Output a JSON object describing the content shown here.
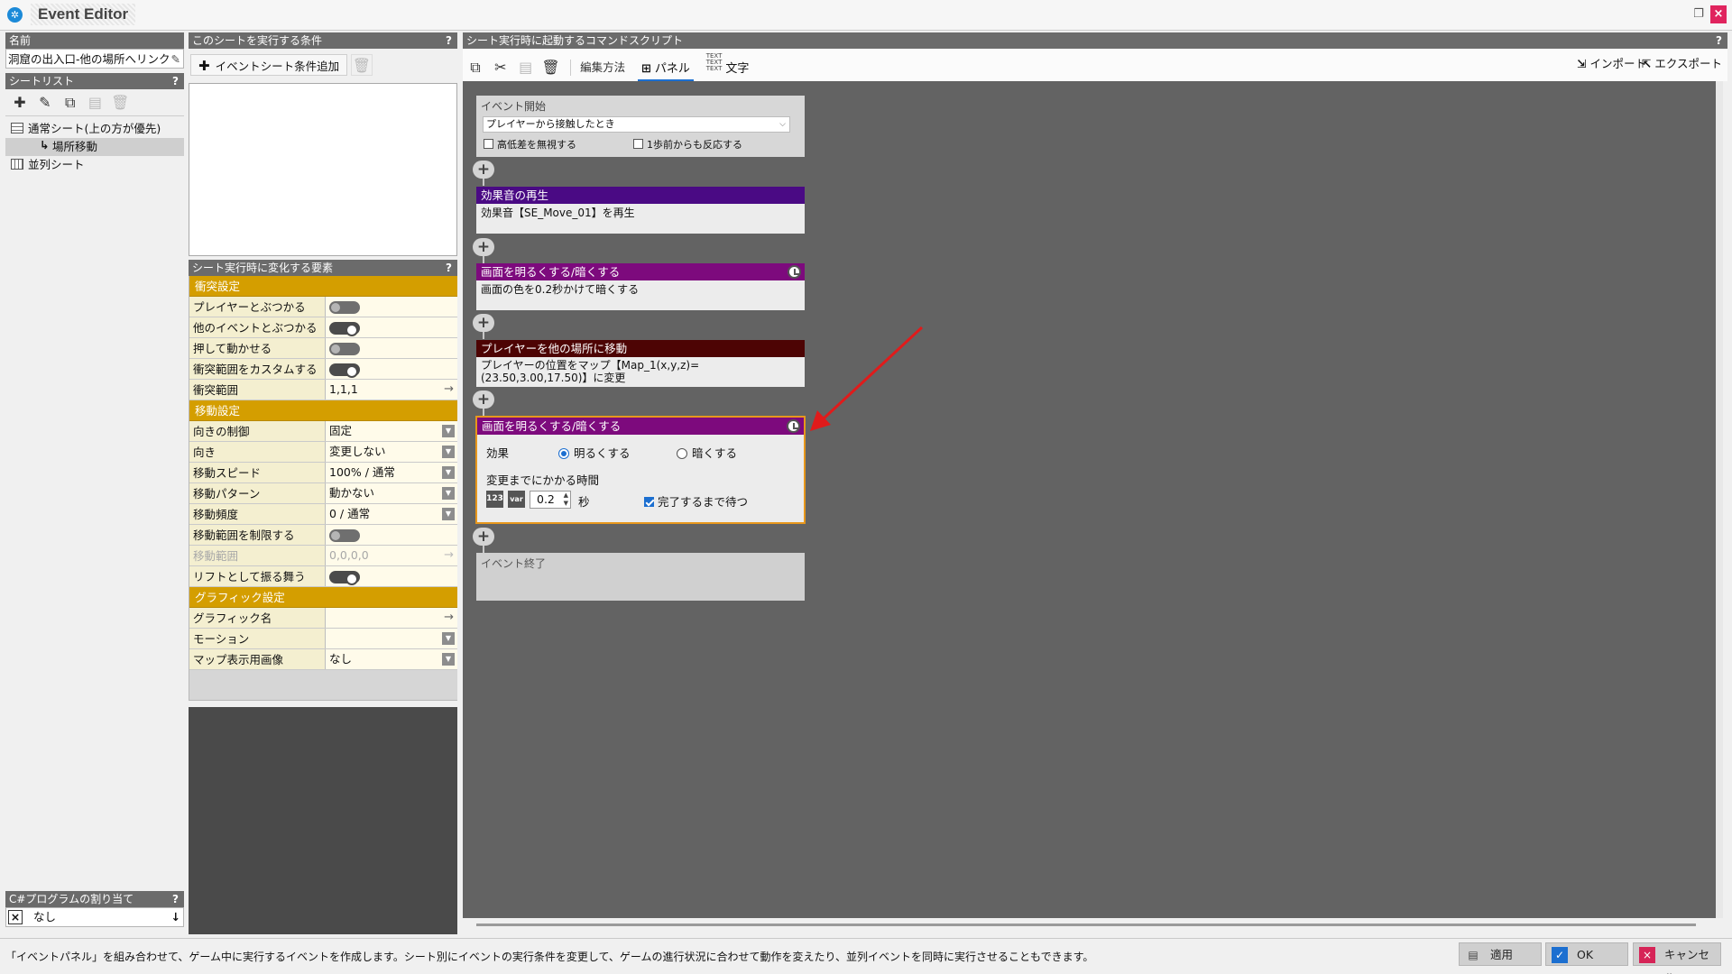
{
  "window": {
    "title": "Event Editor"
  },
  "left": {
    "name_header": "名前",
    "name_value": "洞窟の出入口-他の場所へリンク",
    "sheetlist_header": "シートリスト",
    "sheets": [
      {
        "label": "通常シート(上の方が優先)"
      },
      {
        "label": "場所移動"
      },
      {
        "label": "並列シート"
      }
    ],
    "csharp_header": "C#プログラムの割り当て",
    "csharp_value": "なし"
  },
  "conditions": {
    "header": "このシートを実行する条件",
    "add_label": "イベントシート条件追加"
  },
  "props": {
    "header": "シート実行時に変化する要素",
    "collision": {
      "title": "衝突設定",
      "rows": [
        {
          "key": "プレイヤーとぶつかる",
          "toggle": "off"
        },
        {
          "key": "他のイベントとぶつかる",
          "toggle": "on"
        },
        {
          "key": "押して動かせる",
          "toggle": "off"
        },
        {
          "key": "衝突範囲をカスタムする",
          "toggle": "on"
        },
        {
          "key": "衝突範囲",
          "value": "1,1,1"
        }
      ]
    },
    "movement": {
      "title": "移動設定",
      "rows": [
        {
          "key": "向きの制御",
          "value": "固定"
        },
        {
          "key": "向き",
          "value": "変更しない"
        },
        {
          "key": "移動スピード",
          "value": "100% / 通常"
        },
        {
          "key": "移動パターン",
          "value": "動かない"
        },
        {
          "key": "移動頻度",
          "value": "0 / 通常"
        },
        {
          "key": "移動範囲を制限する",
          "toggle": "off"
        },
        {
          "key": "移動範囲",
          "value": "0,0,0,0"
        },
        {
          "key": "リフトとして振る舞う",
          "toggle": "on"
        }
      ]
    },
    "graphic": {
      "title": "グラフィック設定",
      "rows": [
        {
          "key": "グラフィック名",
          "value": ""
        },
        {
          "key": "モーション",
          "value": ""
        },
        {
          "key": "マップ表示用画像",
          "value": "なし"
        }
      ]
    }
  },
  "script": {
    "header": "シート実行時に起動するコマンドスクリプト",
    "edit_method_label": "編集方法",
    "panel_label": "パネル",
    "text_label": "文字",
    "import_label": "インポート",
    "export_label": "エクスポート",
    "event_start": {
      "title": "イベント開始",
      "trigger": "プレイヤーから接触したとき",
      "ignore_height_label": "高低差を無視する",
      "one_step_label": "1歩前からも反応する"
    },
    "commands": [
      {
        "title": "効果音の再生",
        "body": "効果音【SE_Move_01】を再生",
        "color": "#4a0a84"
      },
      {
        "title": "画面を明るくする/暗くする",
        "body": "画面の色を0.2秒かけて暗くする",
        "color": "#7d0a7d"
      },
      {
        "title": "プレイヤーを他の場所に移動",
        "body": "プレイヤーの位置をマップ【Map_1(x,y,z)=(23.50,3.00,17.50)】に変更",
        "color": "#4d0404"
      },
      {
        "title": "画面を明るくする/暗くする",
        "color": "#7d0a7d"
      }
    ],
    "expanded": {
      "effect_label": "効果",
      "brighten_label": "明るくする",
      "darken_label": "暗くする",
      "selected": "brighten",
      "duration_label": "変更までにかかる時間",
      "duration_value": "0.2",
      "unit": "秒",
      "wait_label": "完了するまで待つ",
      "wait_checked": true
    },
    "event_end": "イベント終了"
  },
  "status": {
    "text": "「イベントパネル」を組み合わせて、ゲーム中に実行するイベントを作成します。シート別にイベントの実行条件を変更して、ゲームの進行状況に合わせて動作を変えたり、並列イベントを同時に実行させることもできます。",
    "apply_label": "適用",
    "ok_label": "OK",
    "cancel_label": "キャンセル"
  },
  "colors": {
    "accent_orange": "#e7971c",
    "section_gold": "#d49e00",
    "annotation_red": "#e01b1b"
  },
  "icons": [
    "plus-icon",
    "pencil-icon",
    "copy-icon",
    "paste-icon",
    "trash-icon",
    "scissors-icon",
    "clock-icon",
    "import-icon",
    "export-icon",
    "check-icon",
    "close-icon"
  ]
}
